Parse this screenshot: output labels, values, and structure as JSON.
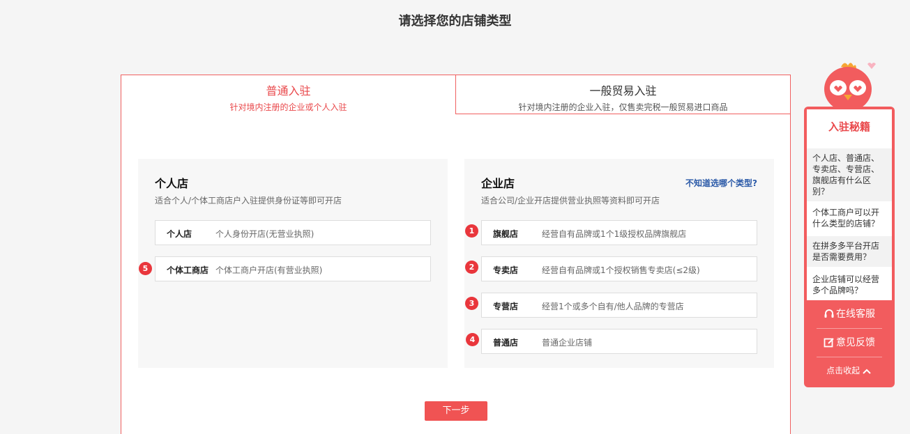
{
  "page": {
    "title": "请选择您的店铺类型"
  },
  "tabs": [
    {
      "name": "普通入驻",
      "desc": "针对境内注册的企业或个人入驻"
    },
    {
      "name": "一般贸易入驻",
      "desc": "针对境内注册的企业入驻，仅售卖完税一般贸易进口商品"
    }
  ],
  "personal": {
    "title": "个人店",
    "subtitle": "适合个人/个体工商店户入驻提供身份证等即可开店",
    "options": [
      {
        "name": "个人店",
        "desc": "个人身份开店(无营业执照)"
      },
      {
        "name": "个体工商店",
        "desc": "个体工商户开店(有营业执照)",
        "badge": "5"
      }
    ]
  },
  "enterprise": {
    "title": "企业店",
    "subtitle": "适合公司/企业开店提供营业执照等资料即可开店",
    "help_link": "不知道选哪个类型?",
    "options": [
      {
        "name": "旗舰店",
        "desc": "经营自有品牌或1个1级授权品牌旗舰店",
        "badge": "1"
      },
      {
        "name": "专卖店",
        "desc": "经营自有品牌或1个授权销售专卖店(≤2级)",
        "badge": "2"
      },
      {
        "name": "专营店",
        "desc": "经营1个或多个自有/他人品牌的专营店",
        "badge": "3"
      },
      {
        "name": "普通店",
        "desc": "普通企业店铺",
        "badge": "4"
      }
    ]
  },
  "next_button": "下一步",
  "side": {
    "title": "入驻秘籍",
    "faqs": [
      "个人店、普通店、专卖店、专营店、旗舰店有什么区别？",
      "个体工商户可以开什么类型的店铺？",
      "在拼多多平台开店是否需要费用？",
      "企业店铺可以经营多个品牌吗？"
    ],
    "online_service": "在线客服",
    "feedback": "意见反馈",
    "collapse": "点击收起"
  },
  "colors": {
    "accent": "#e9474a",
    "widget": "#f25c5e",
    "link": "#2b5aa8"
  }
}
